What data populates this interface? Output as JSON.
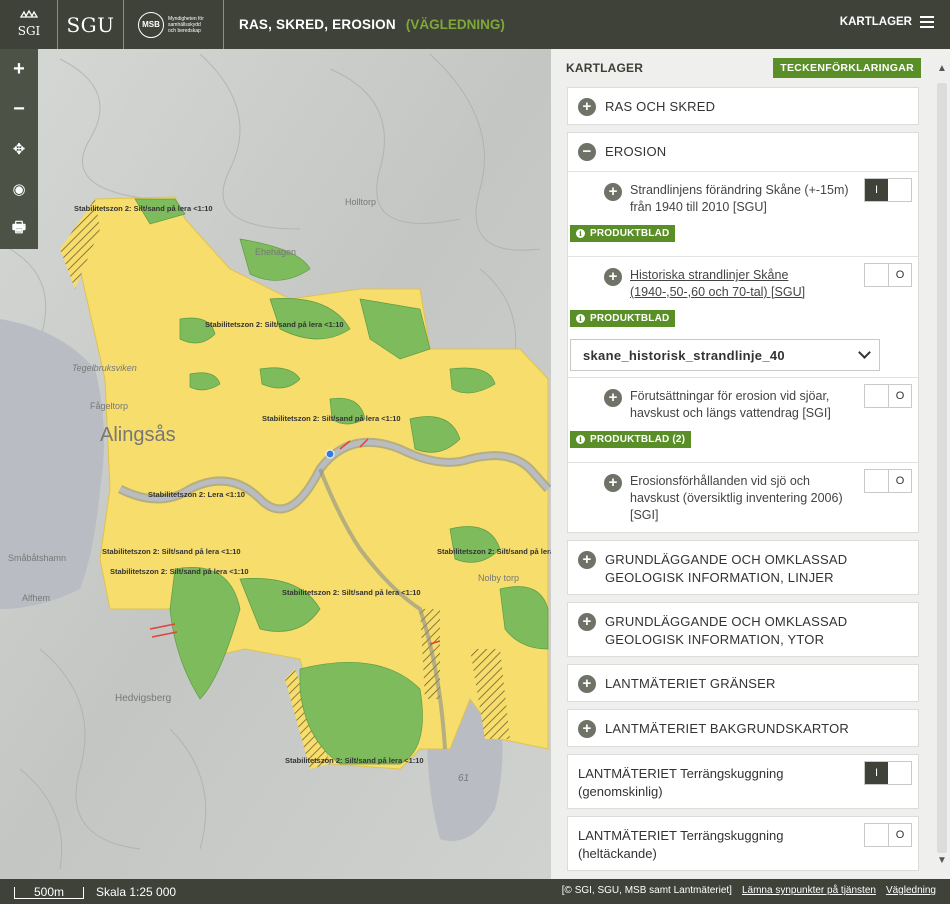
{
  "header": {
    "logo_sgi": "SGI",
    "logo_sgu": "SGU",
    "logo_msb": "MSB",
    "logo_msb_text": "Myndigheten för samhällsskydd och beredskap",
    "title": "RAS, SKRED, EROSION",
    "subtitle": "(VÄGLEDNING)",
    "layers_button": "KARTLAGER"
  },
  "map": {
    "place_labels": [
      {
        "label": "Alingsås"
      },
      {
        "label": "Tegelbruksviken"
      },
      {
        "label": "Fågeltorp"
      },
      {
        "label": "Småbåtshamn"
      },
      {
        "label": "Alfhem"
      },
      {
        "label": "Hedvigsberg"
      },
      {
        "label": "Ehehagen"
      },
      {
        "label": "Holltorp"
      },
      {
        "label": "Nolby torp"
      },
      {
        "label": "61"
      }
    ],
    "zone_labels": [
      "Stabilitetszon 2: Silt/sand på lera <1:10",
      "Stabilitetszon 2: Lera <1:10"
    ]
  },
  "map_tools": [
    "+",
    "−",
    "✥",
    "◉",
    "🖶"
  ],
  "sidebar": {
    "title": "KARTLAGER",
    "legend_button": "TECKENFÖRKLARINGAR",
    "groups": [
      {
        "label": "RAS OCH SKRED"
      },
      {
        "label": "EROSION"
      },
      {
        "label": "GRUNDLÄGGANDE OCH OMKLASSAD GEOLOGISK INFORMATION, LINJER"
      },
      {
        "label": "GRUNDLÄGGANDE OCH OMKLASSAD GEOLOGISK INFORMATION, YTOR"
      },
      {
        "label": "LANTMÄTERIET GRÄNSER"
      },
      {
        "label": "LANTMÄTERIET BAKGRUNDSKARTOR"
      }
    ],
    "erosion_layers": [
      {
        "name": "Strandlinjens förändring Skåne (+-15m) från 1940 till 2010 [SGU]",
        "state": "I",
        "button": "PRODUKTBLAD"
      },
      {
        "name": "Historiska strandlinjer Skåne (1940-,50-,60 och 70-tal) [SGU]",
        "state": "O",
        "button": "PRODUKTBLAD",
        "select_value": "skane_historisk_strandlinje_40"
      },
      {
        "name": "Förutsättningar för erosion vid sjöar, havskust och längs vattendrag [SGI]",
        "state": "O",
        "button": "PRODUKTBLAD (2)"
      },
      {
        "name": "Erosionsförhållanden vid sjö och havskust (översiktlig inventering 2006) [SGI]",
        "state": "O"
      }
    ],
    "terrain": [
      {
        "label": "LANTMÄTERIET Terrängskuggning (genomskinlig)",
        "state": "I"
      },
      {
        "label": "LANTMÄTERIET Terrängskuggning (heltäckande)",
        "state": "O"
      }
    ]
  },
  "footer": {
    "scale_bar": "500m",
    "scale_text": "Skala 1:25 000",
    "credits": "[© SGI, SGU, MSB samt Lantmäteriet]",
    "feedback_link": "Lämna synpunkter på tjänsten",
    "guide_link": "Vägledning"
  },
  "colors": {
    "header_bg": "#3e4238",
    "accent_green": "#5a8f28",
    "zone_yellow": "#f6dd6c",
    "zone_green": "#7dbb5c"
  }
}
